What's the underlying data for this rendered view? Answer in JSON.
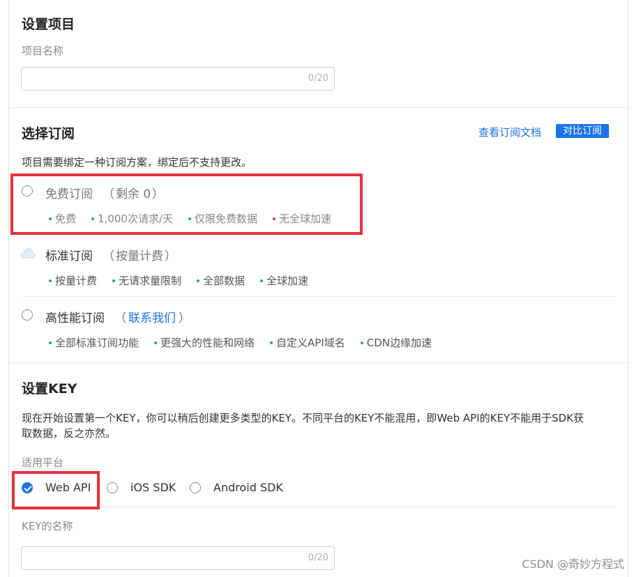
{
  "project_settings": {
    "title": "设置项目",
    "name_label": "项目名称",
    "name_value": "",
    "name_counter": "0/20"
  },
  "subscription": {
    "title": "选择订阅",
    "view_docs_link": "查看订阅文档",
    "compare_button": "对比订阅",
    "description": "项目需要绑定一种订阅方案，绑定后不支持更改。",
    "options": [
      {
        "name": "免费订阅",
        "paren_open": "（",
        "paren_note": "剩余 0",
        "paren_close": "）",
        "features": [
          "免费",
          "1,000次请求/天",
          "仅限免费数据",
          "无全球加速"
        ],
        "feature_dot_colors": [
          "#22b14c",
          "#22b14c",
          "#22b14c",
          "#e5393b"
        ],
        "selected": false,
        "icon": "radio-icon"
      },
      {
        "name": "标准订阅",
        "paren_open": "（",
        "paren_note": "按量计费",
        "paren_close": "）",
        "features": [
          "按量计费",
          "无请求量限制",
          "全部数据",
          "全球加速"
        ],
        "selected": true,
        "icon": "cloud-icon"
      },
      {
        "name": "高性能订阅",
        "paren_open": "（",
        "paren_note": "联系我们",
        "paren_close": "）",
        "features": [
          "全部标准订阅功能",
          "更强大的性能和网络",
          "自定义API域名",
          "CDN边缘加速"
        ],
        "selected": false,
        "icon": "radio-icon"
      }
    ]
  },
  "key_settings": {
    "title": "设置KEY",
    "description_line1": "现在开始设置第一个KEY，你可以稍后创建更多类型的KEY。不同平台的KEY不能混用，即Web API的KEY不能用于SDK获",
    "description_line2": "取数据，反之亦然。",
    "platform_label": "适用平台",
    "platforms": [
      {
        "label": "Web API",
        "checked": true
      },
      {
        "label": "iOS SDK",
        "checked": false
      },
      {
        "label": "Android SDK",
        "checked": false
      }
    ],
    "key_name_label": "KEY的名称",
    "key_name_value": "",
    "key_name_counter": "0/20"
  },
  "watermark": "CSDN @奇妙方程式",
  "colors": {
    "accent": "#1a73e8",
    "highlight_border": "#e8303a",
    "feature_dot_green": "#22b14c",
    "feature_dot_red": "#e5393b"
  }
}
